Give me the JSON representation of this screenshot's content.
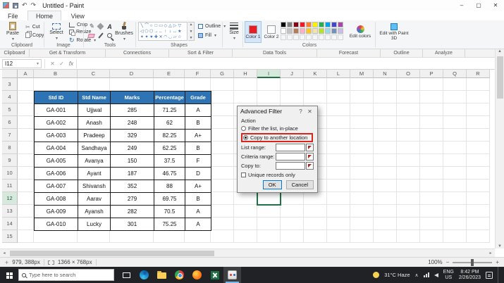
{
  "window": {
    "title": "Untitled - Paint"
  },
  "tabs": [
    {
      "label": "File"
    },
    {
      "label": "Home"
    },
    {
      "label": "View"
    }
  ],
  "ribbon": {
    "paste": "Paste",
    "cut": "Cut",
    "copy": "Copy",
    "select": "Select",
    "crop": "Crop",
    "resize": "Resize",
    "rotate": "Rotate",
    "brushes": "Brushes",
    "outline": "Outline",
    "fill": "Fill",
    "size": "Size",
    "color1": "Color 1",
    "color2": "Color 2",
    "edit_colors": "Edit colors",
    "edit_3d": "Edit with Paint 3D",
    "group_labels": [
      "Clipboard",
      "Image",
      "Tools",
      "Shapes",
      "Colors"
    ],
    "color1_value": "#e81c24",
    "color2_value": "#ffffff",
    "palette": {
      "row1": [
        "#000000",
        "#7f7f7f",
        "#880015",
        "#ed1c24",
        "#ff7f27",
        "#fff200",
        "#22b14c",
        "#00a2e8",
        "#3f48cc",
        "#a349a4"
      ],
      "row2": [
        "#ffffff",
        "#c3c3c3",
        "#b97a57",
        "#ffaec9",
        "#ffc90e",
        "#efe4b0",
        "#b5e61d",
        "#99d9ea",
        "#7092be",
        "#c8bfe7"
      ]
    },
    "shapes": [
      "╲",
      "⌒",
      "○",
      "□",
      "▭",
      "◇",
      "△",
      "▷",
      "▽",
      "◁",
      "⬠",
      "⬡",
      "→",
      "←",
      "↑",
      "↓",
      "↔",
      "★",
      "✶",
      "✦",
      "♥",
      "✚",
      "✕",
      "◠",
      "◡",
      "▱",
      "☆",
      "✧",
      "❖",
      "⬟"
    ]
  },
  "excel": {
    "groups": [
      "Clipboard",
      "Get & Transform",
      "Connections",
      "Sort & Filter",
      "Data Tools",
      "Forecast",
      "Outline",
      "Analyze"
    ],
    "name_box": "I12",
    "fx": "fx",
    "columns": [
      "A",
      "B",
      "C",
      "D",
      "E",
      "F",
      "G",
      "H",
      "I",
      "J",
      "K",
      "L",
      "M",
      "N",
      "O",
      "P",
      "Q",
      "R"
    ],
    "rows": [
      "3",
      "4",
      "5",
      "6",
      "7",
      "8",
      "9",
      "10",
      "11",
      "12",
      "13",
      "14",
      "15"
    ],
    "selected_cell": "I12",
    "table": {
      "header_bg": "#2e74b5",
      "headers": [
        "Std ID",
        "Std Name",
        "Marks",
        "Percentage",
        "Grade"
      ],
      "rows": [
        [
          "GA-001",
          "Ujjwal",
          "285",
          "71.25",
          "A"
        ],
        [
          "GA-002",
          "Anash",
          "248",
          "62",
          "B"
        ],
        [
          "GA-003",
          "Pradeep",
          "329",
          "82.25",
          "A+"
        ],
        [
          "GA-004",
          "Sandhaya",
          "249",
          "62.25",
          "B"
        ],
        [
          "GA-005",
          "Avanya",
          "150",
          "37.5",
          "F"
        ],
        [
          "GA-006",
          "Ayant",
          "187",
          "46.75",
          "D"
        ],
        [
          "GA-007",
          "Shivansh",
          "352",
          "88",
          "A+"
        ],
        [
          "GA-008",
          "Aarav",
          "279",
          "69.75",
          "B"
        ],
        [
          "GA-009",
          "Ayansh",
          "282",
          "70.5",
          "A"
        ],
        [
          "GA-010",
          "Lucky",
          "301",
          "75.25",
          "A"
        ]
      ]
    }
  },
  "dialog": {
    "title": "Advanced Filter",
    "action_label": "Action",
    "option_filter_in_place": "Filter the list, in-place",
    "option_copy_to_location": "Copy to another location",
    "list_range_label": "List range:",
    "criteria_range_label": "Criteria range:",
    "copy_to_label": "Copy to:",
    "unique_label": "Unique records only",
    "ok": "OK",
    "cancel": "Cancel",
    "highlight_color": "#d9261c"
  },
  "statusbar": {
    "coords": "979, 388px",
    "dimensions": "1366 × 768px",
    "zoom": "100%"
  },
  "taskbar": {
    "search_placeholder": "Type here to search",
    "weather": "31°C Haze",
    "lang_top": "ENG",
    "lang_bottom": "US",
    "time": "8:42 PM",
    "date": "2/26/2023"
  }
}
